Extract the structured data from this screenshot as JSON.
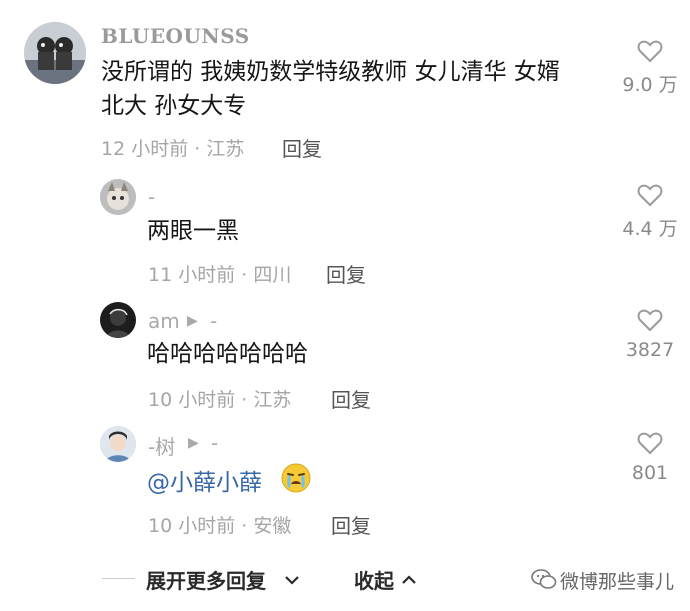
{
  "comments": [
    {
      "user": "BLUEOUNSS",
      "text_line1": "没所谓的 我姨奶数学特级教师 女儿清华 女婿",
      "text_line2": "北大 孙女大专",
      "meta": "12 小时前 · 江苏",
      "reply_label": "回复",
      "likes": "9.0 万"
    },
    {
      "user": "-",
      "text": "两眼一黑",
      "meta": "11 小时前 · 四川",
      "reply_label": "回复",
      "likes": "4.4 万"
    },
    {
      "user": "am",
      "user_suffix": "-",
      "text": "哈哈哈哈哈哈哈",
      "meta": "10 小时前 · 江苏",
      "reply_label": "回复",
      "likes": "3827"
    },
    {
      "user": "-树",
      "user_suffix": "-",
      "mention": "@小薛小薛",
      "emoji": "😭",
      "meta": "10 小时前 · 安徽",
      "reply_label": "回复",
      "likes": "801"
    }
  ],
  "footer": {
    "expand_label": "展开更多回复",
    "collapse_label": "收起"
  },
  "watermark": "微博那些事儿",
  "icons": {
    "like": "heart-outline-icon",
    "play": "play-triangle-icon",
    "chevron_down": "chevron-down-icon",
    "chevron_up": "chevron-up-icon",
    "watermark": "wechat-icon"
  }
}
